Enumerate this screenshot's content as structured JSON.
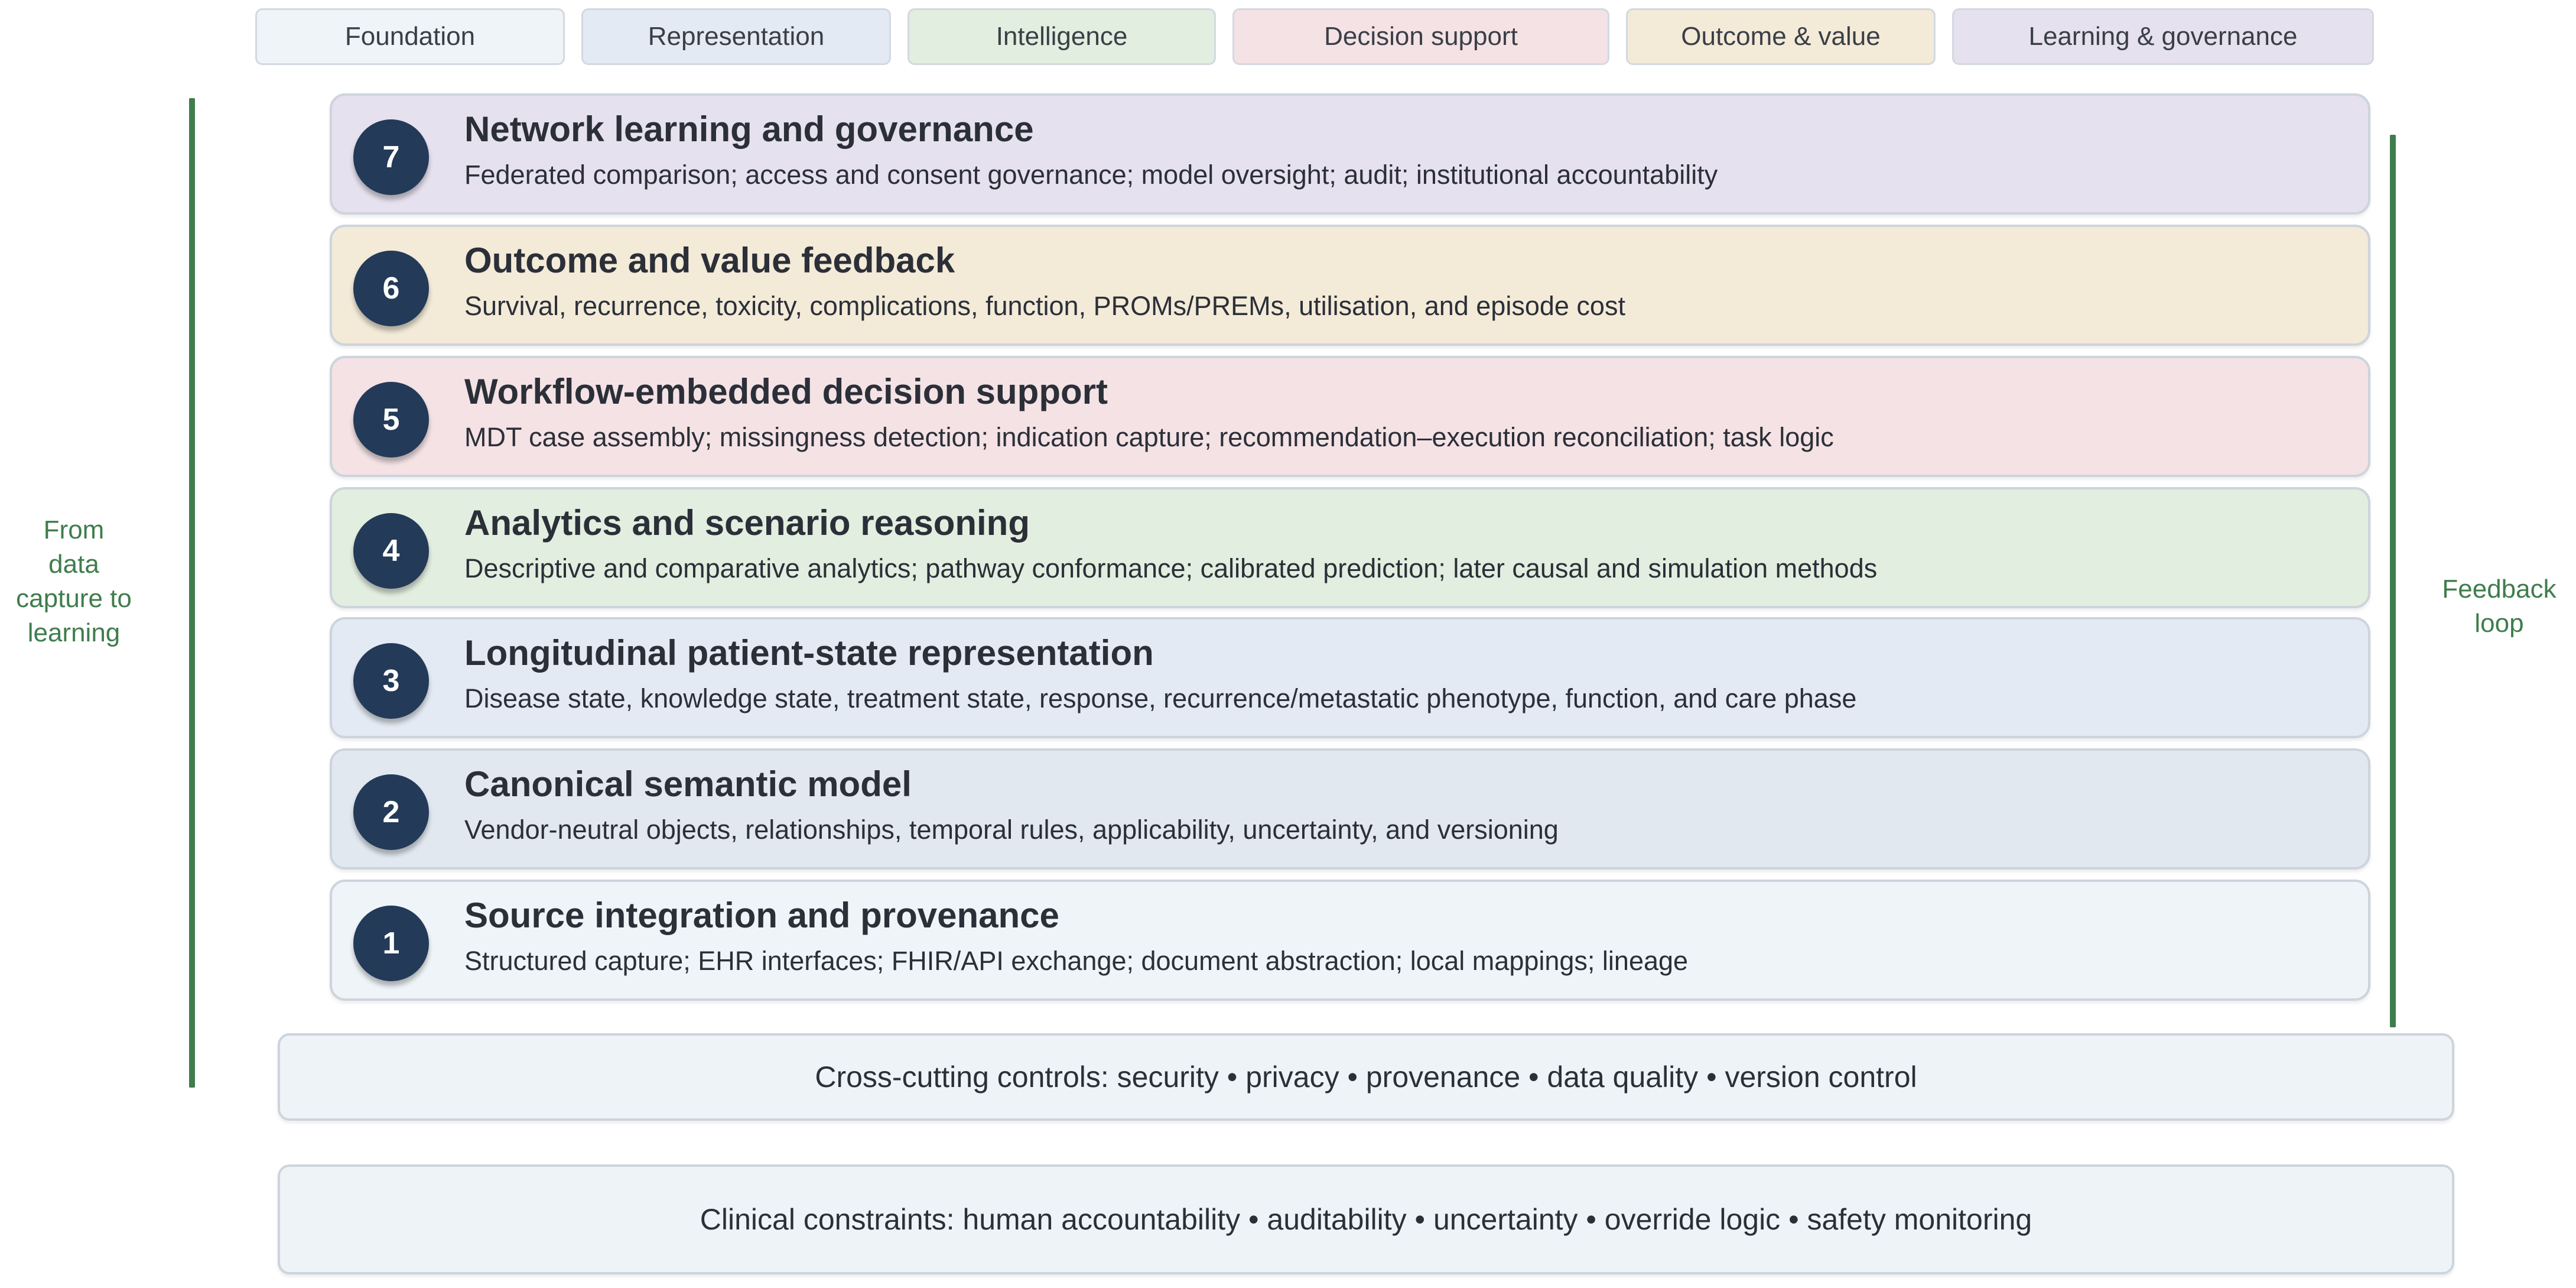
{
  "legend": [
    {
      "label": "Foundation",
      "color": "#eff4f8"
    },
    {
      "label": "Representation",
      "color": "#e3eaf3"
    },
    {
      "label": "Intelligence",
      "color": "#e2eedf"
    },
    {
      "label": "Decision support",
      "color": "#f4e2e5"
    },
    {
      "label": "Outcome & value",
      "color": "#f3ead8"
    },
    {
      "label": "Learning & governance",
      "color": "#e6e1ee"
    }
  ],
  "left_axis": {
    "label": "From\ndata\ncapture to\nlearning",
    "color": "#3f7d4d"
  },
  "right_axis": {
    "label": "Feedback\nloop",
    "color": "#3f7d4d"
  },
  "layers": [
    {
      "number": "7",
      "title": "Network learning and governance",
      "description": "Federated comparison; access and consent governance; model oversight; audit; institutional accountability",
      "color": "#e6e1ee"
    },
    {
      "number": "6",
      "title": "Outcome and value feedback",
      "description": "Survival, recurrence, toxicity, complications, function, PROMs/PREMs, utilisation, and episode cost",
      "color": "#f3ead8"
    },
    {
      "number": "5",
      "title": "Workflow-embedded decision support",
      "description": "MDT case assembly; missingness detection; indication capture; recommendation–execution reconciliation; task logic",
      "color": "#f4e2e5"
    },
    {
      "number": "4",
      "title": "Analytics and scenario reasoning",
      "description": "Descriptive and comparative analytics; pathway conformance; calibrated prediction; later causal and simulation methods",
      "color": "#e2eedf"
    },
    {
      "number": "3",
      "title": "Longitudinal patient-state representation",
      "description": "Disease state, knowledge state, treatment state, response, recurrence/metastatic phenotype, function, and care phase",
      "color": "#e3eaf3"
    },
    {
      "number": "2",
      "title": "Canonical semantic model",
      "description": "Vendor-neutral objects, relationships, temporal rules, applicability, uncertainty, and versioning",
      "color": "#e1e8f0"
    },
    {
      "number": "1",
      "title": "Source integration and provenance",
      "description": "Structured capture; EHR interfaces; FHIR/API exchange; document abstraction; local mappings; lineage",
      "color": "#eff4f8"
    }
  ],
  "bands": {
    "cross_cutting": "Cross-cutting controls: security • privacy • provenance • data quality • version control",
    "clinical": "Clinical constraints: human accountability • auditability • uncertainty • override logic • safety monitoring"
  }
}
